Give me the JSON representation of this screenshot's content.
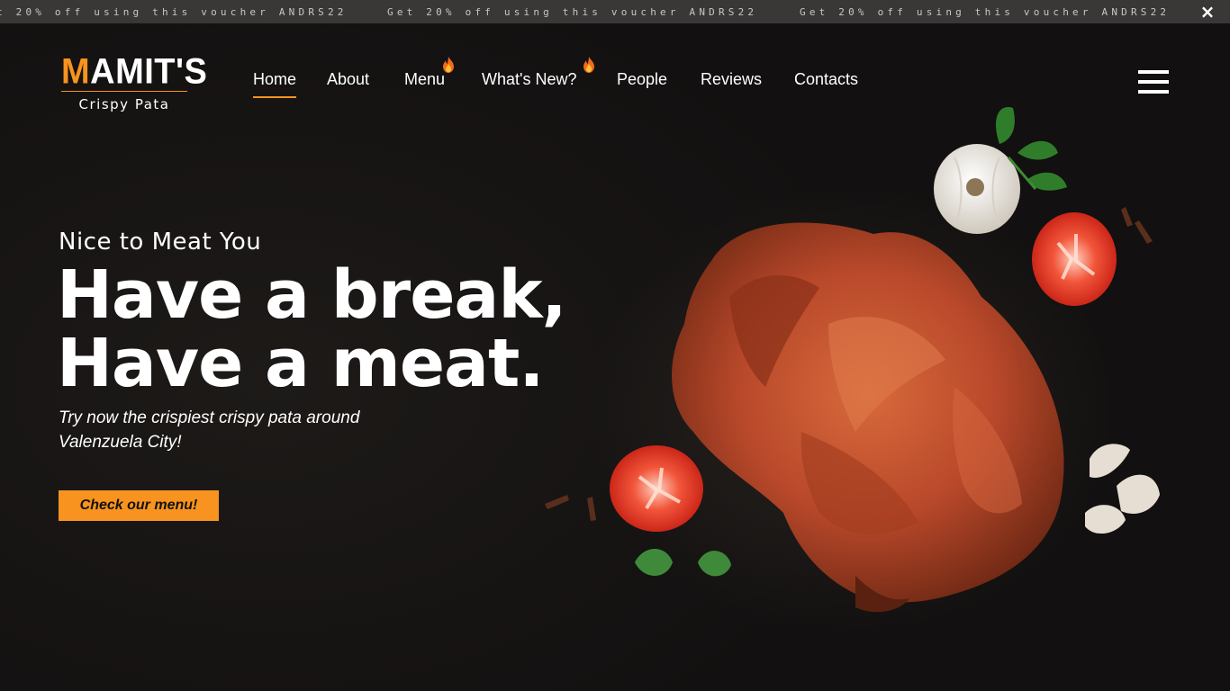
{
  "announcement": {
    "messages": [
      "t 20% off using this voucher ANDRS22",
      "Get 20% off using this voucher ANDRS22",
      "Get 20% off using this voucher ANDRS22"
    ],
    "close_icon": "×"
  },
  "logo": {
    "first_letter": "M",
    "rest": "AMIT'S",
    "subtitle": "Crispy Pata"
  },
  "nav": {
    "items": [
      {
        "label": "Home",
        "active": true
      },
      {
        "label": "About"
      },
      {
        "label": "Menu",
        "badge_icon": "flame-icon"
      },
      {
        "label": "What's New?",
        "badge_icon": "flame-icon"
      },
      {
        "label": "People"
      },
      {
        "label": "Reviews"
      },
      {
        "label": "Contacts"
      }
    ],
    "menu_icon": "hamburger-icon"
  },
  "hero": {
    "tagline": "Nice to Meat You",
    "headline_line1": "Have a break,",
    "headline_line2": "Have a meat.",
    "subtext_line1": "Try now the crispiest crispy pata around",
    "subtext_line2": "Valenzuela City!",
    "cta_label": "Check our menu!",
    "image_subject": "crispy pata with garlic, tomato, basil and parsley"
  },
  "colors": {
    "accent": "#f7931e",
    "background": "#151311",
    "banner": "#3a3837"
  }
}
